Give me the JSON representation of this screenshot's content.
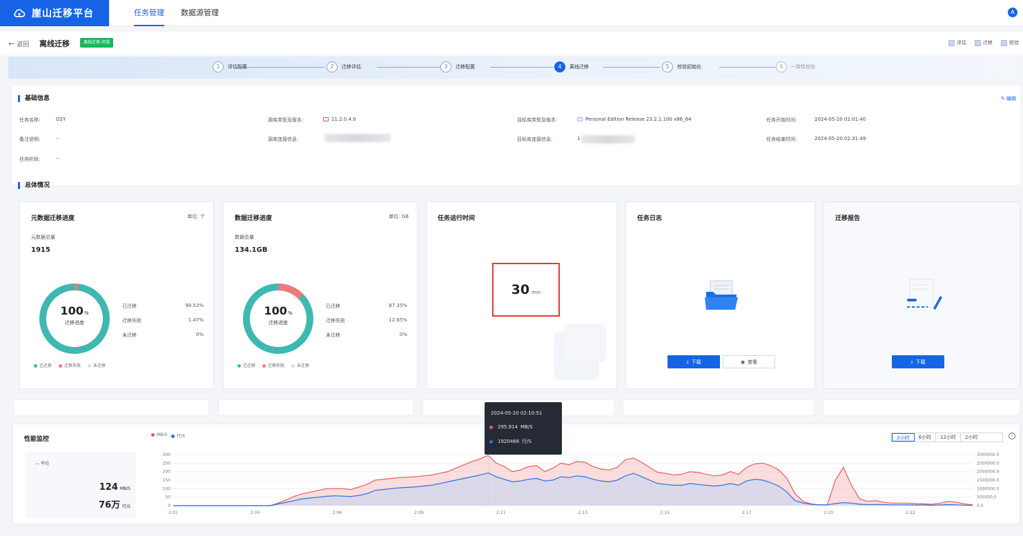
{
  "app": {
    "name": "崖山迁移平台",
    "user_initial": "A"
  },
  "nav": {
    "tabs": [
      {
        "label": "任务管理"
      },
      {
        "label": "数据源管理"
      }
    ]
  },
  "header": {
    "back_label": "返回",
    "title": "离线迁移",
    "status": "离线迁移-完成"
  },
  "legend_checks": [
    "评估",
    "迁移",
    "校验"
  ],
  "steps": [
    {
      "num": "1",
      "label": "评估配置"
    },
    {
      "num": "2",
      "label": "迁移评估"
    },
    {
      "num": "3",
      "label": "迁移配置"
    },
    {
      "num": "4",
      "label": "离线迁移"
    },
    {
      "num": "5",
      "label": "校验初始化"
    },
    {
      "num": "6",
      "label": "一致性校验"
    }
  ],
  "basic_info": {
    "title": "基础信息",
    "edit_label": "编辑",
    "task_name_label": "任务名称:",
    "task_name": "O2Y",
    "remark_label": "备注说明:",
    "remark": "--",
    "stage_label": "任务阶段:",
    "stage": "--",
    "src_type_label": "源库类型及版本:",
    "src_type": "11.2.0.4.0",
    "src_conn_label": "源库连接信息:",
    "dst_type_label": "目标库类型及版本:",
    "dst_type": "Personal Edition Release 23.2.1.100 x86_64",
    "dst_conn_label": "目标库连接信息:",
    "dst_conn": "1",
    "start_label": "任务开始时间:",
    "start": "2024-05-20 02:01:40",
    "end_label": "任务结束时间:",
    "end": "2024-05-20 02:31:49"
  },
  "overview": {
    "title": "总体情况",
    "meta": {
      "title": "元数据迁移进度",
      "unit": "单位: 个",
      "total_label": "元数据总量",
      "total": "1915",
      "pct": "100",
      "pct_unit": "%",
      "center_label": "迁移进度",
      "rows": [
        {
          "label": "已迁移",
          "value": "98.53%"
        },
        {
          "label": "迁移失败",
          "value": "1.47%"
        },
        {
          "label": "未迁移",
          "value": "0%"
        }
      ],
      "migrated_frac": 0.9853,
      "failed_frac": 0.0147,
      "legend": [
        "已迁移",
        "迁移失败",
        "未迁移"
      ]
    },
    "data": {
      "title": "数据迁移进度",
      "unit": "单位: GB",
      "total_label": "数据总量",
      "total": "134.1GB",
      "pct": "100",
      "pct_unit": "%",
      "center_label": "迁移进度",
      "rows": [
        {
          "label": "已迁移",
          "value": "87.35%"
        },
        {
          "label": "迁移失败",
          "value": "12.65%"
        },
        {
          "label": "未迁移",
          "value": "0%"
        }
      ],
      "migrated_frac": 0.8735,
      "failed_frac": 0.1265,
      "legend": [
        "已迁移",
        "迁移失败",
        "未迁移"
      ]
    },
    "runtime": {
      "title": "任务运行时间",
      "value": "30",
      "unit": "min"
    },
    "log": {
      "title": "任务日志",
      "download": "下载",
      "view": "查看"
    },
    "report": {
      "title": "迁移报告",
      "download": "下载"
    }
  },
  "perf": {
    "title": "性能监控",
    "legend": [
      "MB/S",
      "行/S"
    ],
    "avg_label": "平均",
    "avg_mb": "124",
    "avg_mb_unit": "MB/S",
    "avg_rows": "76万",
    "avg_rows_unit": "行/S",
    "ranges": [
      "2小时",
      "6小时",
      "12小时",
      "2小时"
    ],
    "tooltip": {
      "time": "2024-05-20 02:10:51",
      "mb": "295.914",
      "mb_unit": "MB/S",
      "rows": "1920466",
      "rows_unit": "行/S"
    }
  },
  "chart_data": {
    "type": "area",
    "x_ticks": [
      "2:01",
      "2:04",
      "2:06",
      "2:09",
      "2:11",
      "2:13",
      "2:15",
      "2:17",
      "2:20",
      "2:22"
    ],
    "y_ticks_left": [
      "0",
      "50",
      "100",
      "150",
      "200",
      "250",
      "300"
    ],
    "y_ticks_right": [
      "0.0",
      "500000.0",
      "1000000.0",
      "1500000.0",
      "2000000.0",
      "2500000.0",
      "3000000.0"
    ],
    "ylim_left": [
      0,
      300
    ],
    "ylim_right": [
      0,
      3000000
    ],
    "colors": {
      "mb": "#e85a5a",
      "rows": "#2b6fe0"
    },
    "series": [
      {
        "name": "MB/S",
        "values": [
          0,
          0,
          0,
          0,
          0,
          0,
          0,
          0,
          0,
          0,
          0,
          0,
          0,
          15,
          35,
          55,
          70,
          80,
          90,
          100,
          100,
          100,
          95,
          110,
          125,
          150,
          155,
          160,
          165,
          168,
          170,
          175,
          180,
          190,
          200,
          220,
          240,
          260,
          275,
          295,
          250,
          230,
          200,
          210,
          230,
          235,
          200,
          220,
          250,
          240,
          260,
          255,
          230,
          215,
          210,
          225,
          270,
          280,
          255,
          225,
          195,
          190,
          180,
          185,
          200,
          195,
          185,
          175,
          180,
          200,
          185,
          225,
          245,
          250,
          235,
          210,
          160,
          70,
          25,
          10,
          5,
          5,
          150,
          225,
          120,
          40,
          25,
          30,
          20,
          15,
          15,
          15,
          12,
          10,
          8,
          15,
          25,
          20,
          10,
          5
        ]
      },
      {
        "name": "行/S",
        "values": [
          0,
          0,
          0,
          0,
          0,
          0,
          0,
          0,
          0,
          0,
          0,
          0,
          0,
          100000,
          200000,
          300000,
          400000,
          450000,
          500000,
          550000,
          580000,
          560000,
          540000,
          600000,
          700000,
          900000,
          950000,
          1000000,
          1050000,
          1080000,
          1100000,
          1150000,
          1200000,
          1300000,
          1400000,
          1500000,
          1600000,
          1700000,
          1800000,
          1920466,
          1700000,
          1550000,
          1400000,
          1450000,
          1550000,
          1600000,
          1450000,
          1500000,
          1700000,
          1650000,
          1750000,
          1700000,
          1550000,
          1450000,
          1400000,
          1500000,
          1750000,
          1900000,
          1700000,
          1500000,
          1300000,
          1250000,
          1200000,
          1200000,
          1300000,
          1250000,
          1200000,
          1150000,
          1200000,
          1300000,
          1200000,
          1450000,
          1550000,
          1500000,
          1350000,
          1150000,
          800000,
          300000,
          150000,
          80000,
          50000,
          50000,
          120000,
          180000,
          150000,
          80000,
          60000,
          70000,
          60000,
          50000,
          50000,
          50000,
          40000,
          40000,
          30000,
          40000,
          60000,
          50000,
          30000,
          20000
        ]
      }
    ]
  }
}
